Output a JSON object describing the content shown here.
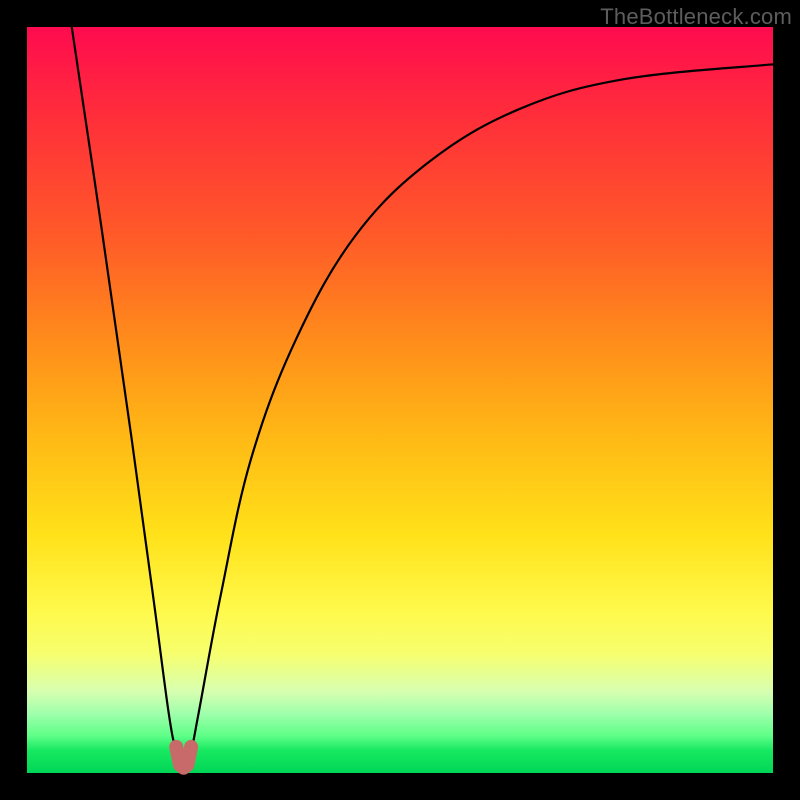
{
  "watermark": "TheBottleneck.com",
  "chart_data": {
    "type": "line",
    "title": "",
    "xlabel": "",
    "ylabel": "",
    "xlim": [
      0,
      100
    ],
    "ylim": [
      0,
      100
    ],
    "series": [
      {
        "name": "bottleneck-curve",
        "color": "#000000",
        "x": [
          6.0,
          10,
          14,
          17,
          19,
          20,
          21,
          22,
          23,
          26,
          30,
          36,
          44,
          54,
          66,
          80,
          100
        ],
        "y": [
          100,
          73,
          45,
          23,
          8,
          3,
          1,
          3,
          8,
          24,
          42,
          58,
          72,
          82,
          89,
          93,
          95
        ]
      },
      {
        "name": "min-marker",
        "color": "#c96a6a",
        "x": [
          20,
          20.5,
          21,
          21.5,
          22
        ],
        "y": [
          3.5,
          1.1,
          0.7,
          1.1,
          3.5
        ]
      }
    ],
    "gradient_stops": [
      {
        "pos": 0.0,
        "color": "#ff0b4f"
      },
      {
        "pos": 0.12,
        "color": "#ff2e3a"
      },
      {
        "pos": 0.28,
        "color": "#ff5a28"
      },
      {
        "pos": 0.42,
        "color": "#ff8c1b"
      },
      {
        "pos": 0.55,
        "color": "#ffb915"
      },
      {
        "pos": 0.68,
        "color": "#ffe119"
      },
      {
        "pos": 0.78,
        "color": "#fff94a"
      },
      {
        "pos": 0.84,
        "color": "#f7ff6e"
      },
      {
        "pos": 0.89,
        "color": "#d8ffb0"
      },
      {
        "pos": 0.92,
        "color": "#a0ffac"
      },
      {
        "pos": 0.95,
        "color": "#5fff88"
      },
      {
        "pos": 0.97,
        "color": "#17e860"
      },
      {
        "pos": 1.0,
        "color": "#00d656"
      }
    ]
  }
}
